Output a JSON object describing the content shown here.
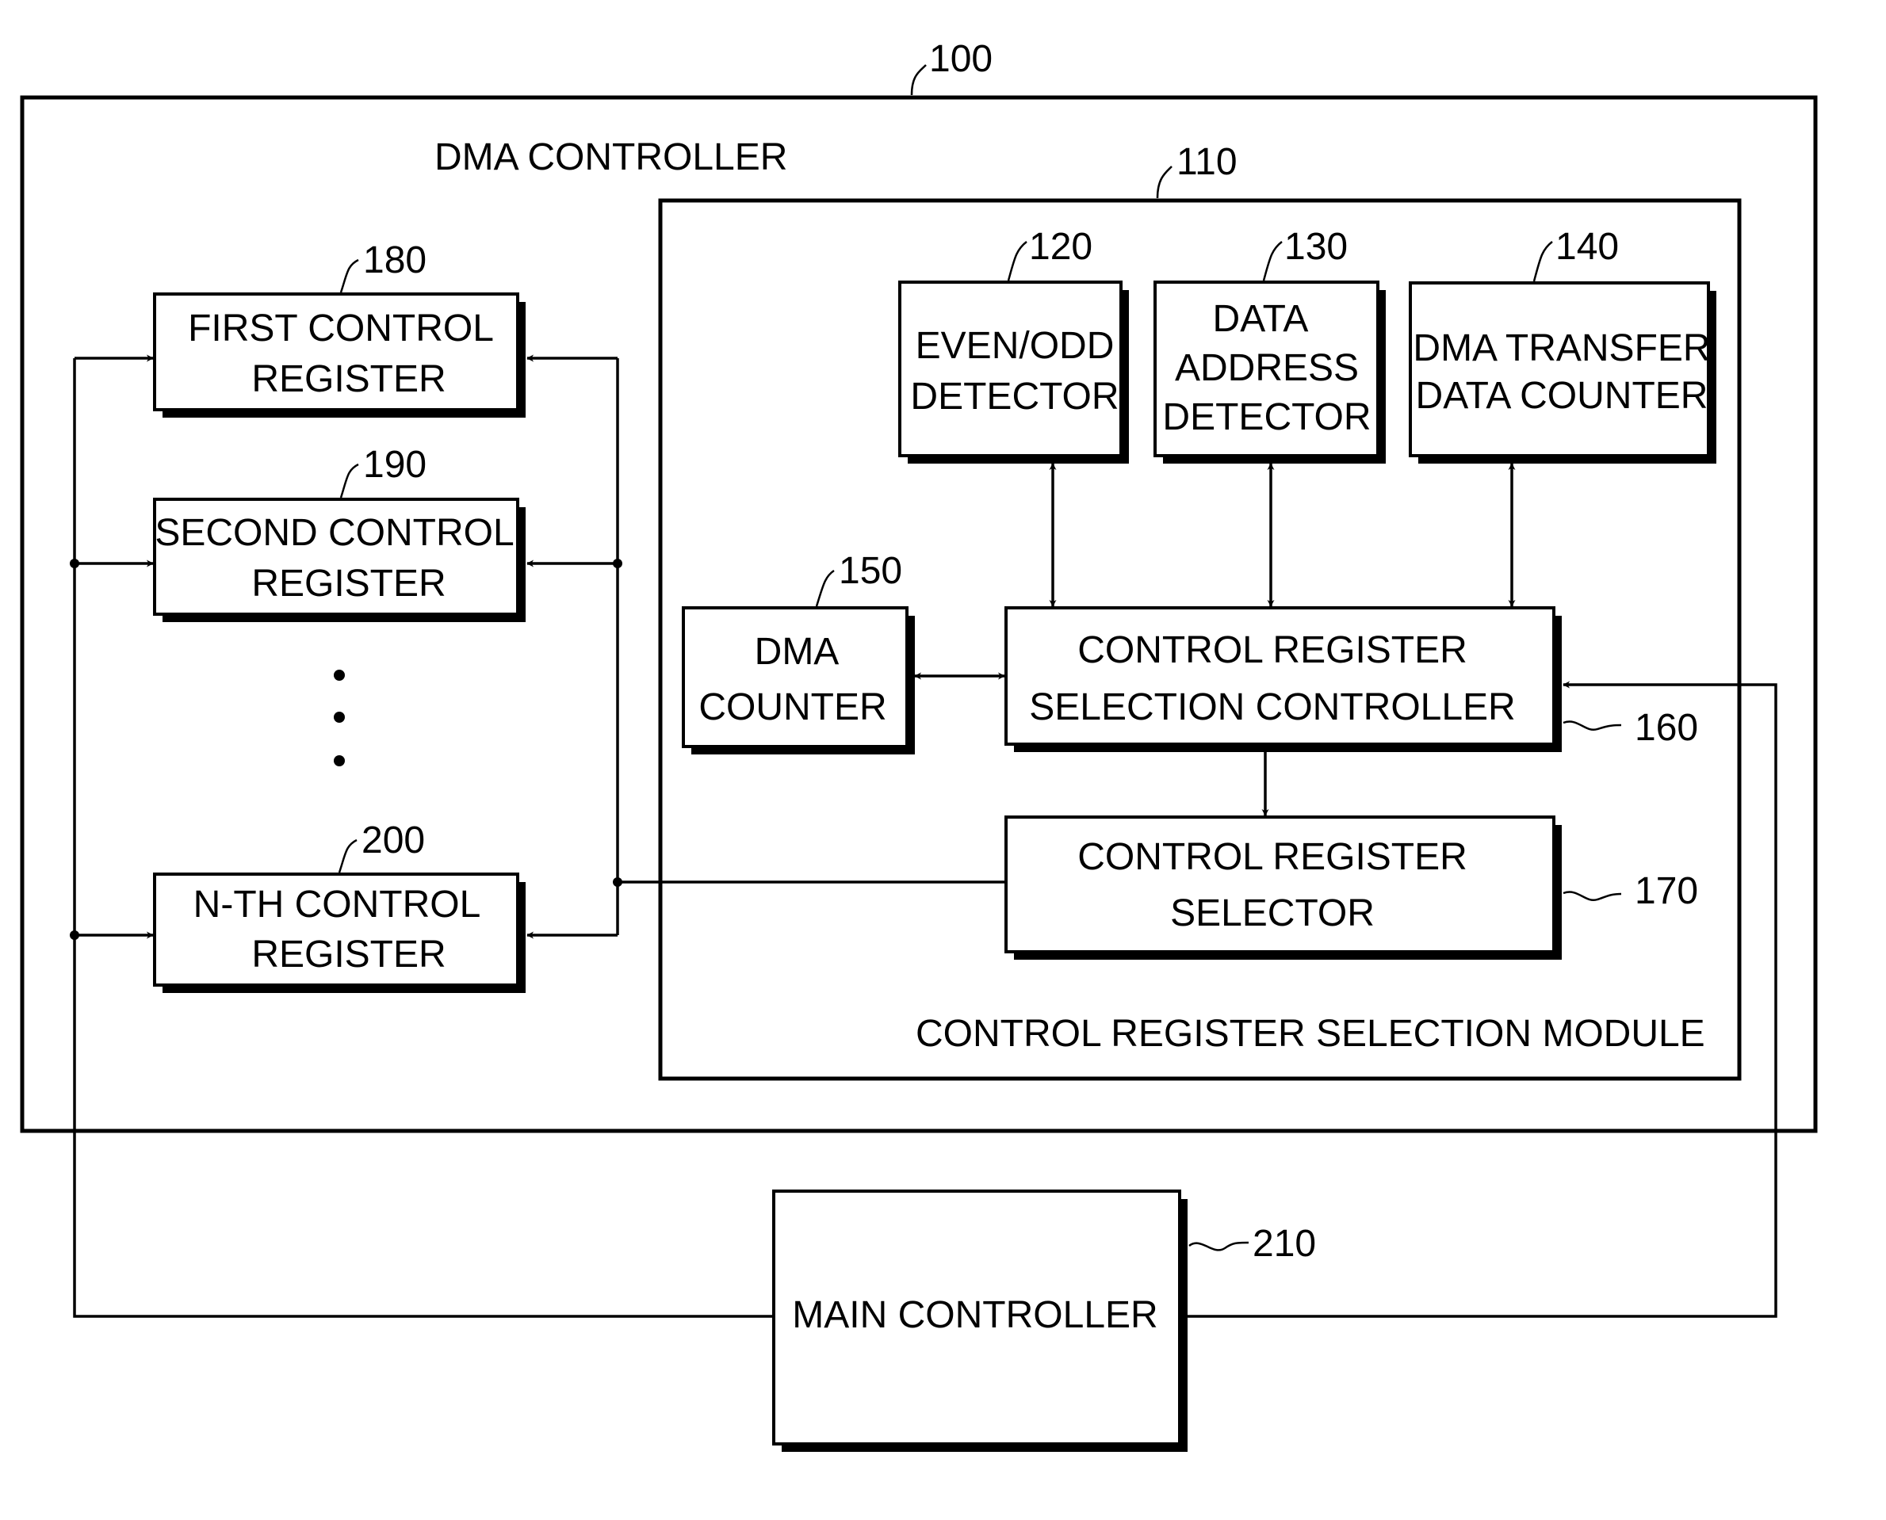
{
  "figure": {
    "outer": {
      "ref": "100",
      "title": "DMA CONTROLLER"
    },
    "module": {
      "ref": "110",
      "title": "CONTROL REGISTER SELECTION MODULE"
    },
    "blocks": {
      "even_odd": {
        "ref": "120",
        "line1": "EVEN/ODD",
        "line2": "DETECTOR"
      },
      "data_address": {
        "ref": "130",
        "line1": "DATA",
        "line2": "ADDRESS",
        "line3": "DETECTOR"
      },
      "transfer_counter": {
        "ref": "140",
        "line1": "DMA TRANSFER",
        "line2": "DATA COUNTER"
      },
      "dma_counter": {
        "ref": "150",
        "line1": "DMA",
        "line2": "COUNTER"
      },
      "selection_controller": {
        "ref": "160",
        "line1": "CONTROL REGISTER",
        "line2": "SELECTION CONTROLLER"
      },
      "selector": {
        "ref": "170",
        "line1": "CONTROL REGISTER",
        "line2": "SELECTOR"
      },
      "first_reg": {
        "ref": "180",
        "line1": "FIRST CONTROL",
        "line2": "REGISTER"
      },
      "second_reg": {
        "ref": "190",
        "line1": "SECOND CONTROL",
        "line2": "REGISTER"
      },
      "nth_reg": {
        "ref": "200",
        "line1": "N-TH CONTROL",
        "line2": "REGISTER"
      },
      "main_controller": {
        "ref": "210",
        "line1": "MAIN CONTROLLER"
      }
    },
    "ellipsis": "⋮"
  }
}
